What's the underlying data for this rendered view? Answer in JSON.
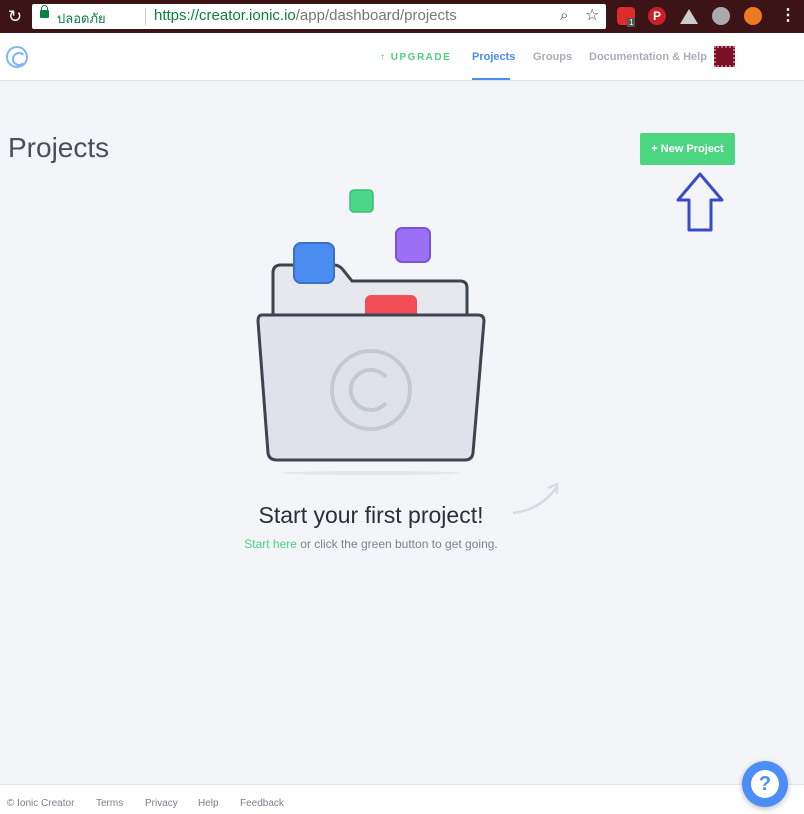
{
  "browser": {
    "secure_label": "ปลอดภัย",
    "url_main": "https://creator.ionic.io",
    "url_path": "/app/dashboard/projects",
    "extension_badge_count": "1"
  },
  "header": {
    "upgrade": "↑ UPGRADE",
    "nav": [
      "Projects",
      "Groups",
      "Documentation & Help"
    ],
    "active_tab": "Projects"
  },
  "main": {
    "title": "Projects",
    "new_project_label": "+ New Project",
    "empty_heading": "Start your first project!",
    "empty_link": "Start here",
    "empty_text": " or click the green button to get going."
  },
  "footer": {
    "copyright": "© Ionic Creator",
    "links": [
      "Terms",
      "Privacy",
      "Help",
      "Feedback"
    ]
  },
  "help_button": "?",
  "colors": {
    "accent_green": "#4cd580",
    "accent_blue": "#4a8cf0",
    "annotation_arrow": "#3a4ac8"
  },
  "icons": [
    "reload-icon",
    "lock-icon",
    "zoom-icon",
    "star-icon",
    "ionic-logo-icon",
    "folder-illustration",
    "question-icon"
  ]
}
